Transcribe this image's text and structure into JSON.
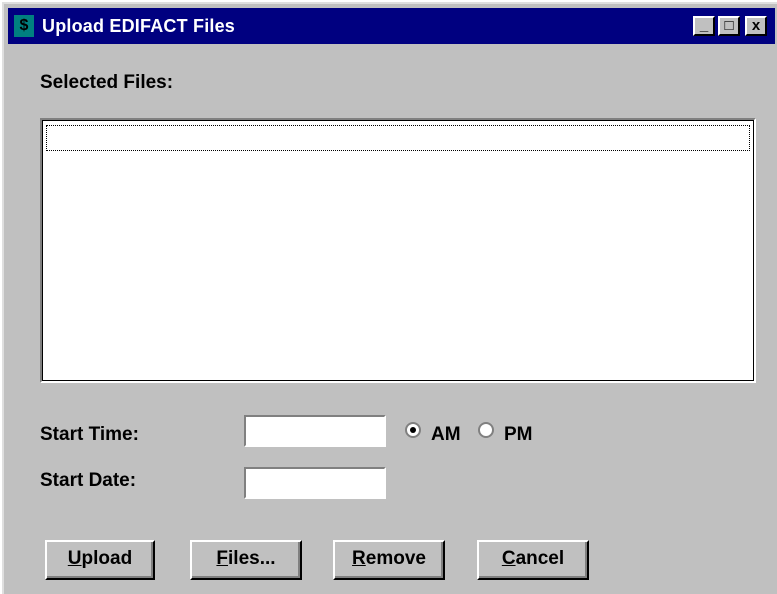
{
  "window": {
    "title": "Upload EDIFACT Files",
    "app_icon": "$",
    "controls": {
      "minimize": "_",
      "maximize": "□",
      "close": "x"
    }
  },
  "selected_files": {
    "label": "Selected Files:",
    "items": []
  },
  "start_time": {
    "label": "Start Time:",
    "value": "",
    "selected_meridiem": "AM"
  },
  "meridiem": {
    "am_label": "AM",
    "pm_label": "PM"
  },
  "start_date": {
    "label": "Start Date:",
    "value": ""
  },
  "buttons": {
    "upload": {
      "mnemonic": "U",
      "rest": "pload"
    },
    "files": {
      "mnemonic": "F",
      "rest": "iles..."
    },
    "remove": {
      "mnemonic": "R",
      "rest": "emove"
    },
    "cancel": {
      "mnemonic": "C",
      "rest": "ancel"
    }
  }
}
